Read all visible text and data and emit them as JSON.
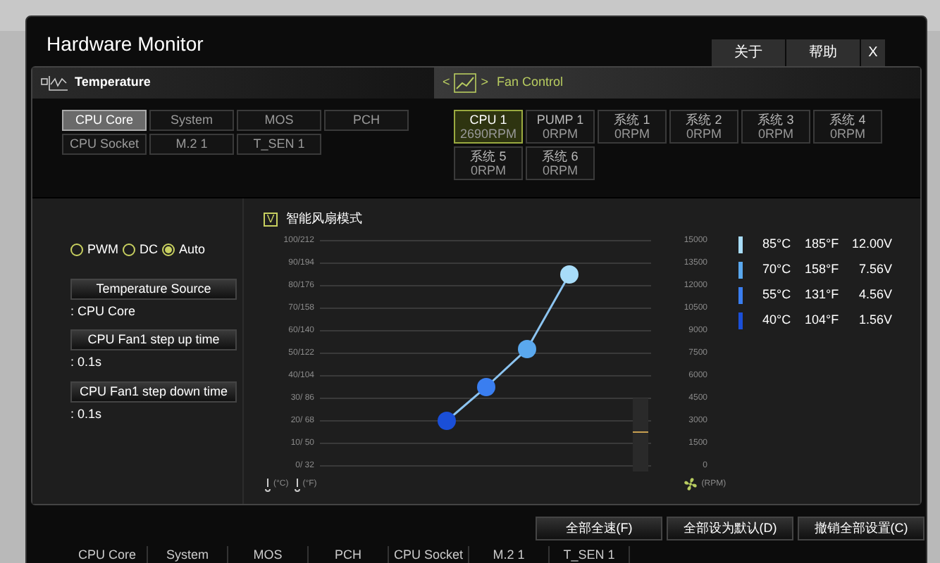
{
  "window": {
    "title": "Hardware Monitor",
    "buttons": [
      "关于",
      "帮助",
      "X"
    ]
  },
  "temperature": {
    "title": "Temperature",
    "sources": [
      {
        "label": "CPU Core",
        "selected": true
      },
      {
        "label": "System",
        "selected": false
      },
      {
        "label": "MOS",
        "selected": false
      },
      {
        "label": "PCH",
        "selected": false
      },
      {
        "label": "CPU Socket",
        "selected": false
      },
      {
        "label": "M.2 1",
        "selected": false
      },
      {
        "label": "T_SEN 1",
        "selected": false
      }
    ]
  },
  "fan_control": {
    "title": "Fan Control",
    "prev": "<",
    "next": ">",
    "fans": [
      {
        "name": "CPU 1",
        "rpm": "2690RPM",
        "selected": true
      },
      {
        "name": "PUMP 1",
        "rpm": "0RPM",
        "selected": false
      },
      {
        "name": "系统 1",
        "rpm": "0RPM",
        "selected": false
      },
      {
        "name": "系统 2",
        "rpm": "0RPM",
        "selected": false
      },
      {
        "name": "系统 3",
        "rpm": "0RPM",
        "selected": false
      },
      {
        "name": "系统 4",
        "rpm": "0RPM",
        "selected": false
      },
      {
        "name": "系统 5",
        "rpm": "0RPM",
        "selected": false
      },
      {
        "name": "系统 6",
        "rpm": "0RPM",
        "selected": false
      }
    ]
  },
  "mode": {
    "options": [
      {
        "label": "PWM",
        "selected": false
      },
      {
        "label": "DC",
        "selected": false
      },
      {
        "label": "Auto",
        "selected": true
      }
    ]
  },
  "settings": [
    {
      "label": "Temperature Source",
      "value": ": CPU Core"
    },
    {
      "label": "CPU Fan1 step up time",
      "value": ": 0.1s"
    },
    {
      "label": "CPU Fan1 step down time",
      "value": ": 0.1s"
    }
  ],
  "smart_fan": {
    "label": "智能风扇模式",
    "checked": true,
    "check_mark": "V"
  },
  "curve": {
    "left_ticks": [
      "100/212",
      "90/194",
      "80/176",
      "70/158",
      "60/140",
      "50/122",
      "40/104",
      "30/ 86",
      "20/ 68",
      "10/ 50",
      "0/ 32"
    ],
    "right_ticks": [
      "15000",
      "13500",
      "12000",
      "10500",
      "9000",
      "7500",
      "6000",
      "4500",
      "3000",
      "1500",
      "0"
    ],
    "left_units": [
      "(°C)",
      "(°F)"
    ],
    "right_unit": "(RPM)",
    "points": [
      {
        "celsius": "85°C",
        "fahrenheit": "185°F",
        "voltage": "12.00V",
        "color": "#a8dcf8"
      },
      {
        "celsius": "70°C",
        "fahrenheit": "158°F",
        "voltage": "7.56V",
        "color": "#5aa8ee"
      },
      {
        "celsius": "55°C",
        "fahrenheit": "131°F",
        "voltage": "4.56V",
        "color": "#3a7ef0"
      },
      {
        "celsius": "40°C",
        "fahrenheit": "104°F",
        "voltage": "1.56V",
        "color": "#1a4fd8"
      }
    ]
  },
  "bottom_buttons": [
    "全部全速(F)",
    "全部设为默认(D)",
    "撤销全部设置(C)"
  ],
  "sensors": [
    "CPU Core",
    "System",
    "MOS",
    "PCH",
    "CPU Socket",
    "M.2 1",
    "T_SEN 1"
  ]
}
